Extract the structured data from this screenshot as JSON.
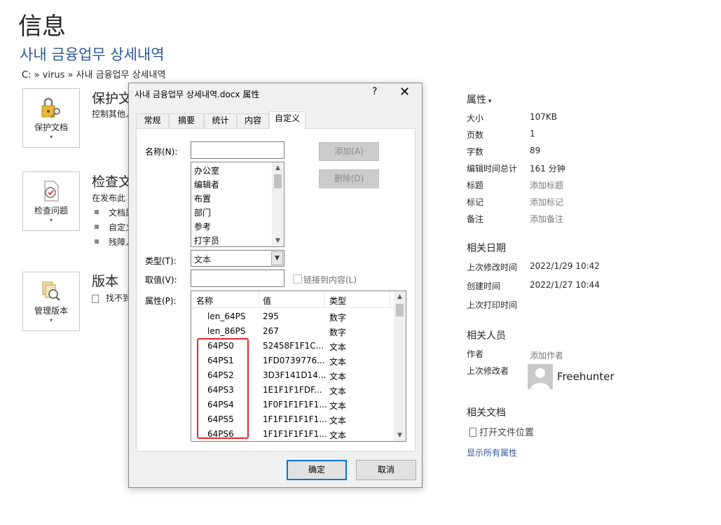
{
  "page": {
    "title": "信息",
    "doc_title": "사내 금융업무 상세내역",
    "path": "C: » virus » 사내 금융업무 상세내역"
  },
  "sections": {
    "protect": {
      "button_label": "保护文档",
      "heading": "保护文",
      "text": "控制其他人"
    },
    "inspect": {
      "button_label": "检查问题",
      "heading": "检查文",
      "text": "在发布此",
      "bullets": [
        "文档属",
        "自定义",
        "残障人"
      ]
    },
    "versions": {
      "button_label": "管理版本",
      "heading": "版本",
      "text": "找不到"
    }
  },
  "properties": {
    "heading": "属性",
    "rows": [
      {
        "key": "大小",
        "value": "107KB"
      },
      {
        "key": "页数",
        "value": "1"
      },
      {
        "key": "字数",
        "value": "89"
      },
      {
        "key": "编辑时间总计",
        "value": "161 分钟"
      },
      {
        "key": "标题",
        "value": "添加标题"
      },
      {
        "key": "标记",
        "value": "添加标记"
      },
      {
        "key": "备注",
        "value": "添加备注"
      }
    ],
    "dates_heading": "相关日期",
    "dates": [
      {
        "key": "上次修改时间",
        "value": "2022/1/29 10:42"
      },
      {
        "key": "创建时间",
        "value": "2022/1/27 10:44"
      },
      {
        "key": "上次打印时间",
        "value": ""
      }
    ],
    "people_heading": "相关人员",
    "author_label": "作者",
    "author_value": "添加作者",
    "last_modified_by_label": "上次修改者",
    "last_modified_by": "Freehunter",
    "docs_heading": "相关文档",
    "open_location": "打开文件位置",
    "show_all": "显示所有属性"
  },
  "dialog": {
    "title": "사내 금융업무 상세내역.docx 属性",
    "help": "?",
    "close": "✕",
    "tabs": [
      "常规",
      "摘要",
      "统计",
      "内容",
      "自定义"
    ],
    "active_tab": "自定义",
    "name_label": "名称(N):",
    "name_value": "",
    "add_button": "添加(A)",
    "delete_button": "删除(D)",
    "name_list": [
      "办公室",
      "编辑者",
      "布置",
      "部门",
      "参考",
      "打字员"
    ],
    "type_label": "类型(T):",
    "type_value": "文本",
    "value_label": "取值(V):",
    "value_value": "",
    "link_label": "链接到内容(L)",
    "link_checked": false,
    "props_label": "属性(P):",
    "table_headers": [
      "名称",
      "值",
      "类型"
    ],
    "table_rows": [
      {
        "name": "len_64PS",
        "value": "295",
        "type": "数字"
      },
      {
        "name": "len_86PS",
        "value": "267",
        "type": "数字"
      },
      {
        "name": "64PS0",
        "value": "52458F1F1C...",
        "type": "文本"
      },
      {
        "name": "64PS1",
        "value": "1FD0739776...",
        "type": "文本"
      },
      {
        "name": "64PS2",
        "value": "3D3F141D14...",
        "type": "文本"
      },
      {
        "name": "64PS3",
        "value": "1E1F1F1FDF...",
        "type": "文本"
      },
      {
        "name": "64PS4",
        "value": "1F0F1F1F1F1...",
        "type": "文本"
      },
      {
        "name": "64PS5",
        "value": "1F1F1F1F1F1...",
        "type": "文本"
      },
      {
        "name": "64PS6",
        "value": "1F1F1F1F1F1...",
        "type": "文本"
      }
    ],
    "ok_button": "确定",
    "cancel_button": "取消"
  },
  "colors": {
    "accent": "#2b579a",
    "highlight": "#e0262b",
    "focus": "#0078d7"
  }
}
